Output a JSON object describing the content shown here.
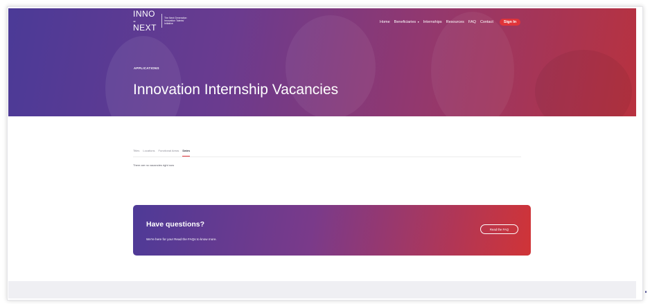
{
  "logo": {
    "mark": "INNO -NEXT",
    "tagline": "The Next Generation Innovation Talents' Initiative"
  },
  "nav": {
    "items": [
      "Home",
      "Beneficiaries",
      "Internships",
      "Resources",
      "FAQ",
      "Contact"
    ],
    "beneficiaries_caret": "▾",
    "sign_in": "Sign In"
  },
  "hero": {
    "eyebrow": "APPLICATIONS",
    "title": "Innovation Internship Vacancies"
  },
  "filters": {
    "tabs": [
      "Titles",
      "Locations",
      "Functional Areas",
      "Dates"
    ],
    "active_index": 3,
    "empty_message": "There are no vacancies right now"
  },
  "cta": {
    "title": "Have questions?",
    "text": "We're here for you! Read the FAQs to know more.",
    "button": "Read the FAQ"
  },
  "colors": {
    "accent": "#e0343a",
    "gradient_start": "#4b3a97",
    "gradient_end": "#b8323f"
  }
}
